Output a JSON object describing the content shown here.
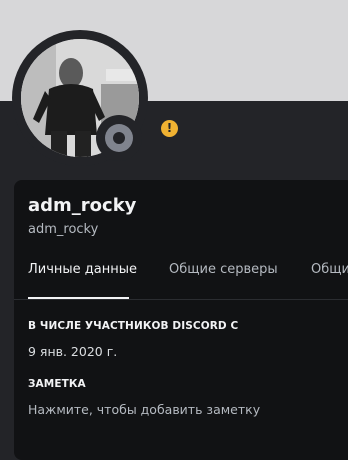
{
  "profile": {
    "display_name": "adm_rocky",
    "username": "adm_rocky",
    "status": "offline",
    "warning_badge": "!"
  },
  "tabs": [
    {
      "label": "Личные данные",
      "active": true
    },
    {
      "label": "Общие серверы",
      "active": false
    },
    {
      "label": "Общи",
      "active": false
    }
  ],
  "member_since": {
    "title": "В ЧИСЛЕ УЧАСТНИКОВ DISCORD С",
    "value": "9 янв. 2020 г."
  },
  "note": {
    "title": "ЗАМЕТКА",
    "placeholder": "Нажмите, чтобы добавить заметку"
  },
  "colors": {
    "banner": "#d7d7d9",
    "panel": "#111214",
    "background": "#232428",
    "status_offline": "#80848e",
    "badge": "#f0b232"
  }
}
